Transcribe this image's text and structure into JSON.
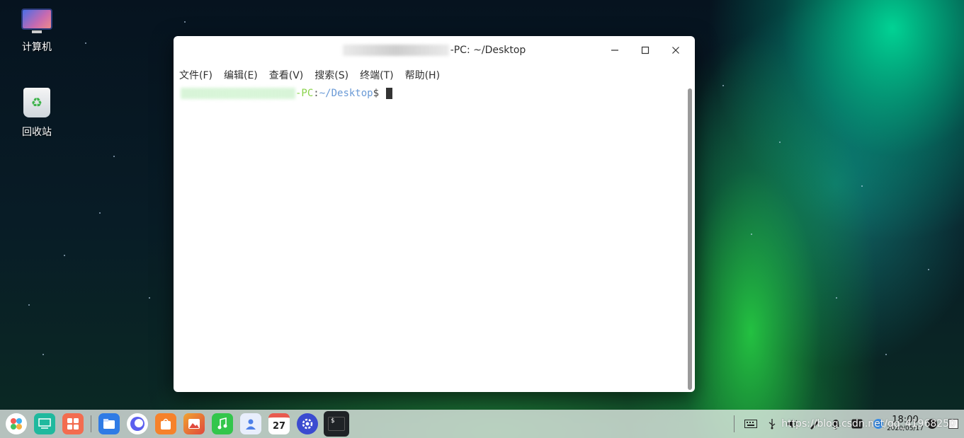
{
  "desktop": {
    "icons": [
      {
        "label": "计算机"
      },
      {
        "label": "回收站"
      }
    ]
  },
  "terminal": {
    "title_suffix": "-PC: ~/Desktop",
    "menu": [
      "文件(F)",
      "编辑(E)",
      "查看(V)",
      "搜索(S)",
      "终端(T)",
      "帮助(H)"
    ],
    "prompt": {
      "host_suffix": "-PC",
      "separator": ":",
      "path": "~/Desktop",
      "dollar": "$"
    }
  },
  "taskbar": {
    "apps": [
      {
        "icon": "launcher-icon",
        "color": "#ffffff"
      },
      {
        "icon": "multitask-view-icon",
        "color": "#1fb99e"
      },
      {
        "icon": "app-store-grid-icon",
        "color": "#f36c4f"
      },
      {
        "icon": "file-manager-icon",
        "color": "#2f7be5"
      },
      {
        "icon": "browser-icon",
        "color": "#5b5fef"
      },
      {
        "icon": "shopping-bag-icon",
        "color": "#f6822b"
      },
      {
        "icon": "photos-icon",
        "color": "#f0a430"
      },
      {
        "icon": "music-icon",
        "color": "#33c64b"
      },
      {
        "icon": "contacts-icon",
        "color": "#4d7fe8"
      },
      {
        "icon": "calendar-icon",
        "color": "#ffffff",
        "text": "27"
      },
      {
        "icon": "settings-gear-icon",
        "color": "#3b4bd0"
      }
    ],
    "active_app": {
      "icon": "terminal-icon",
      "text": "$"
    },
    "tray": {
      "time": "18:00",
      "date": "2020/05/17",
      "watermark": "https://blog.csdn.net/qq_41968250"
    }
  }
}
